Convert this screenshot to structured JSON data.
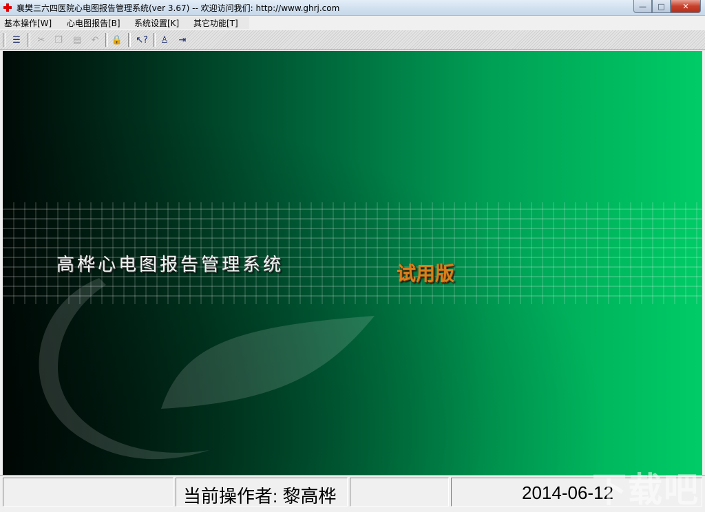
{
  "window": {
    "title": "襄樊三六四医院心电图报告管理系统(ver 3.67) -- 欢迎访问我们: http://www.ghrj.com",
    "minimize_symbol": "—",
    "maximize_symbol": "□",
    "close_symbol": "✕"
  },
  "menu": {
    "items": [
      {
        "label": "基本操作[W]"
      },
      {
        "label": "心电图报告[B]"
      },
      {
        "label": "系统设置[K]"
      },
      {
        "label": "其它功能[T]"
      }
    ]
  },
  "toolbar": {
    "buttons": [
      {
        "icon": "form-icon",
        "glyph": "☰",
        "enabled": true
      },
      {
        "icon": "cut-icon",
        "glyph": "✂",
        "enabled": false
      },
      {
        "icon": "copy-icon",
        "glyph": "❐",
        "enabled": false
      },
      {
        "icon": "paste-icon",
        "glyph": "▤",
        "enabled": false
      },
      {
        "icon": "undo-icon",
        "glyph": "↶",
        "enabled": false
      },
      {
        "icon": "lock-icon",
        "glyph": "🔒",
        "enabled": true
      },
      {
        "icon": "help-pointer-icon",
        "glyph": "↖?",
        "enabled": true
      },
      {
        "icon": "user-icon",
        "glyph": "♙",
        "enabled": true
      },
      {
        "icon": "exit-icon",
        "glyph": "⇥",
        "enabled": true
      }
    ]
  },
  "banner": {
    "system_name": "高桦心电图报告管理系统",
    "trial_label": "试用版"
  },
  "status": {
    "operator": "当前操作者: 黎高桦",
    "date": "2014-06-12"
  },
  "watermark": "下载吧",
  "colors": {
    "background_dark": "#000a06",
    "background_bright": "#00cc66",
    "trial_orange": "#d8801e"
  }
}
